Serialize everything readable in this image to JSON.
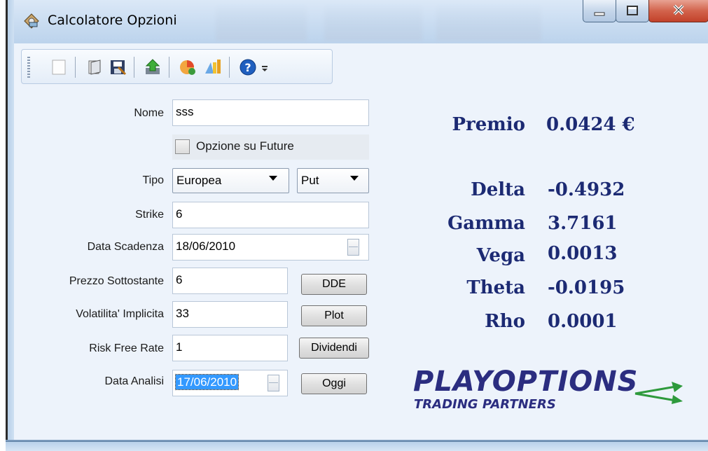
{
  "window": {
    "title": "Calcolatore Opzioni",
    "controls": [
      "minimize-icon",
      "maximize-icon",
      "close-icon"
    ]
  },
  "toolbar": {
    "icons": [
      "new-document-icon",
      "open-icon",
      "save-icon",
      "export-icon",
      "chart-icon",
      "settings-icon",
      "help-icon",
      "overflow-icon"
    ]
  },
  "form": {
    "nome": {
      "label": "Nome",
      "value": "sss"
    },
    "future": {
      "label": "Opzione su Future",
      "checked": false
    },
    "tipo": {
      "label": "Tipo",
      "style_value": "Europea",
      "kind_value": "Put"
    },
    "strike": {
      "label": "Strike",
      "value": "6"
    },
    "scadenza": {
      "label": "Data Scadenza",
      "value": "18/06/2010"
    },
    "prezzo": {
      "label": "Prezzo Sottostante",
      "value": "6",
      "button": "DDE"
    },
    "volatilita": {
      "label": "Volatilita' Implicita",
      "value": "33",
      "button": "Plot"
    },
    "risk_free": {
      "label": "Risk Free Rate",
      "value": "1",
      "button": "Dividendi"
    },
    "analisi": {
      "label": "Data Analisi",
      "value": "17/06/2010",
      "button": "Oggi"
    }
  },
  "results": {
    "premio": {
      "label": "Premio",
      "value": "0.0424 €"
    },
    "delta": {
      "label": "Delta",
      "value": "-0.4932"
    },
    "gamma": {
      "label": "Gamma",
      "value": "3.7161"
    },
    "vega": {
      "label": "Vega",
      "value": "0.0013"
    },
    "theta": {
      "label": "Theta",
      "value": "-0.0195"
    },
    "rho": {
      "label": "Rho",
      "value": "0.0001"
    }
  },
  "logo": {
    "main": "PLAYOPTIONS",
    "sub": "TRADING PARTNERS"
  },
  "colors": {
    "result_text": "#1c2a73",
    "logo": "#2b2d80",
    "logo_arrows": "#2e9a3c",
    "selection": "#3399ff"
  }
}
